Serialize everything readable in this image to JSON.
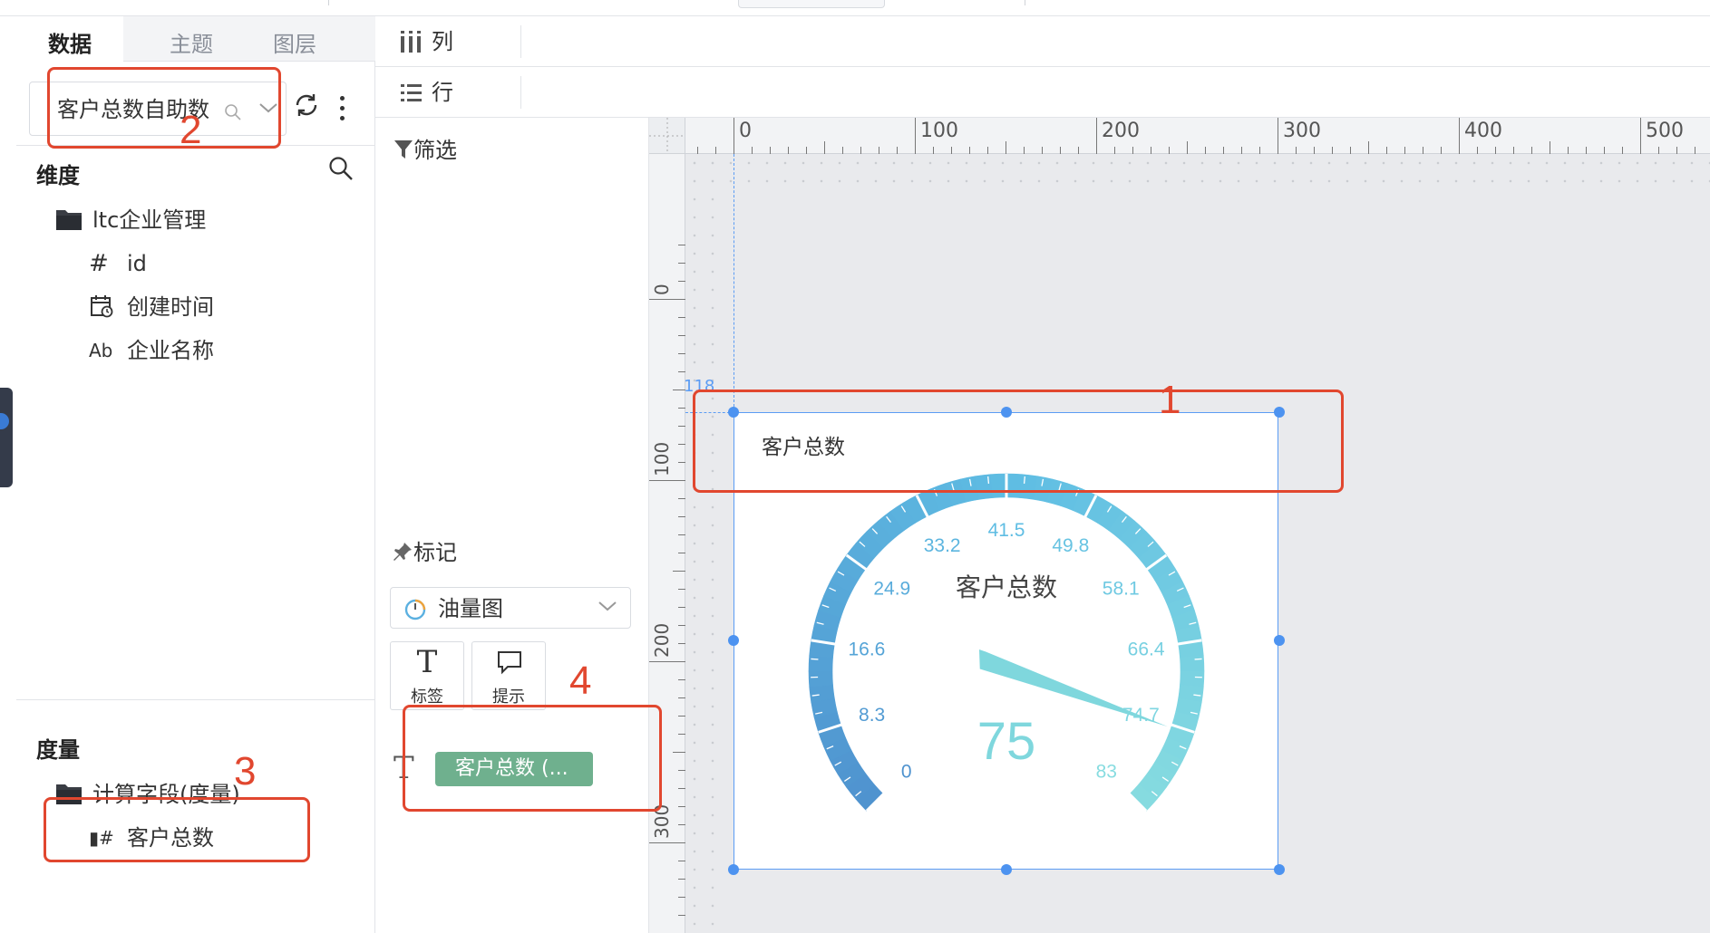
{
  "data_panel": {
    "tabs": [
      "数据",
      "主题",
      "图层"
    ],
    "datasource": "客户总数自助数",
    "dimension_title": "维度",
    "folder": "ltc企业管理",
    "fields": [
      {
        "type_glyph": "#",
        "label": "id"
      },
      {
        "type_glyph": "calendar",
        "label": "创建时间"
      },
      {
        "type_glyph": "Ab",
        "label": "企业名称"
      }
    ],
    "measure_title": "度量",
    "measure_folder": "计算字段(度量)",
    "measure_field": "客户总数",
    "measure_glyph": "▮#"
  },
  "shelves": {
    "columns": "列",
    "rows": "行",
    "filter": "筛选",
    "marks": "标记",
    "chart_type": "油量图",
    "label_btn": "标签",
    "tooltip_btn": "提示",
    "pill": "客户总数 (...",
    "pill_glyph": "T",
    "label_glyph": "T"
  },
  "canvas": {
    "ruler_x_labels": [
      "0",
      "100",
      "200",
      "300",
      "400",
      "500"
    ],
    "ruler_y_labels": [
      "0",
      "100",
      "200",
      "300"
    ],
    "guide_value": "118",
    "widget_title": "客户总数"
  },
  "chart_data": {
    "type": "gauge",
    "title": "客户总数",
    "min": 0,
    "max": 83,
    "value": 75,
    "ticks": [
      "0",
      "8.3",
      "16.6",
      "24.9",
      "33.2",
      "41.5",
      "49.8",
      "58.1",
      "66.4",
      "74.7",
      "83"
    ],
    "value_label": "75",
    "colors": {
      "start": "#4f93cf",
      "mid": "#5fbde3",
      "end": "#87dce0",
      "needle": "#7fd7dd"
    }
  },
  "annotations": [
    "1",
    "2",
    "3",
    "4"
  ],
  "colors": {
    "accent": "#4d93f0",
    "annotation": "#e1472f",
    "pill": "#6fb08e"
  }
}
